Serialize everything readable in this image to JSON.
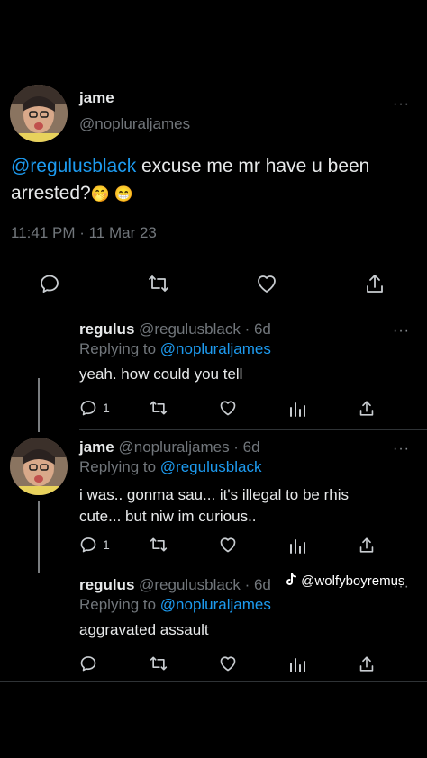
{
  "main_tweet": {
    "display_name": "jame",
    "handle": "@nopluraljames",
    "mention": "@regulusblack",
    "text_line1": " excuse me mr have u been",
    "text_line2": "arrested?",
    "emojis": "🤭 😁",
    "timestamp": "11:41 PM · 11 Mar 23",
    "more_label": "···"
  },
  "replies": [
    {
      "display_name": "regulus",
      "handle_time": "@regulusblack · 6d",
      "replying_label": "Replying to ",
      "replying_to": "@nopluraljames",
      "text": "yeah. how could you tell",
      "reply_count": "1",
      "more_label": "···"
    },
    {
      "display_name": "jame",
      "handle_time": "@nopluraljames · 6d",
      "replying_label": "Replying to ",
      "replying_to": "@regulusblack",
      "text_line1": "i was.. gonma sau... it's illegal to be rhis",
      "text_line2": "cute... but niw im curious..",
      "reply_count": "1",
      "more_label": "···"
    },
    {
      "display_name": "regulus",
      "handle_time": "@regulusblack · 6d",
      "replying_label": "Replying to ",
      "replying_to": "@nopluraljames",
      "text": "aggravated assault",
      "more_label": "···"
    }
  ],
  "watermark": {
    "text": "@wolfyboyremus",
    "icon": "tiktok-icon"
  },
  "colors": {
    "background": "#000000",
    "text": "#e7e9ea",
    "muted": "#71767b",
    "link": "#1d9bf0",
    "divider": "#2f3336"
  }
}
